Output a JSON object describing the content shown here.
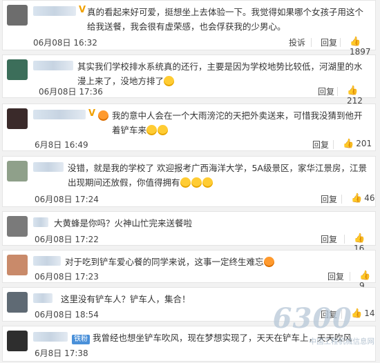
{
  "comments": [
    {
      "text": "真的看起来好可爱，挺想坐上去体验一下。我觉得如果哪个女孩子用这个给我送餐，我会很有虚荣感，也会俘获我的少男心。",
      "date": "06月08日 16:32",
      "actions": [
        "投诉",
        "回复"
      ],
      "likes": "1897",
      "badge": "V"
    },
    {
      "text": "其实我们学校排水系统真的还行，主要是因为学校地势比较低，河湖里的水漫上来了，没地方排了",
      "date": "06月08日 17:36",
      "actions": [
        "回复"
      ],
      "likes": "212"
    },
    {
      "text": "我的意中人会在一个大雨滂沱的天把外卖送来，可惜我没猜到他开着铲车来",
      "date": "6月8日 16:49",
      "actions": [
        "回复"
      ],
      "likes": "201",
      "badge": "V"
    },
    {
      "text": "没错，就是我的学校了 欢迎报考广西海洋大学，5A级景区，家华江景房，江景出现期间还放假，你值得拥有",
      "date": "06月08日 17:24",
      "actions": [
        "回复"
      ],
      "likes": "46"
    },
    {
      "text": "大黄蜂是你吗？火神山忙完来送餐啦",
      "date": "06月08日 17:22",
      "actions": [
        "回复"
      ],
      "likes": "16"
    },
    {
      "text": "对于吃到铲车爱心餐的同学来说，这事一定终生难忘",
      "date": "06月08日 17:23",
      "actions": [
        "回复"
      ],
      "likes": "9"
    },
    {
      "text": "这里没有铲车人？铲车人，集合！",
      "date": "06月08日 18:54",
      "actions": [
        "回复"
      ],
      "likes": "14"
    },
    {
      "text": "我曾经也想坐铲车吹风，现在梦想实现了，天天在铲车上，天天吹风",
      "date": "6月8日 17:38",
      "actions": [
        "回复"
      ],
      "likes": "",
      "vip": "铁粉"
    }
  ],
  "watermark": {
    "logo": "6300",
    "site": "中国工程机械信息网"
  }
}
